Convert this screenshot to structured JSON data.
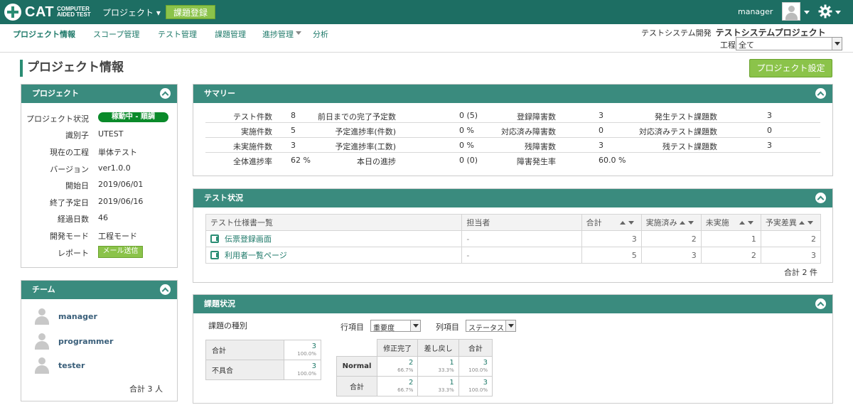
{
  "app": {
    "logo_main": "CAT",
    "logo_sub": "COMPUTER AIDED TEST",
    "project_menu": "プロジェクト",
    "register_issue": "課題登録",
    "user": "manager"
  },
  "nav": {
    "items": [
      "プロジェクト情報",
      "スコープ管理",
      "テスト管理",
      "課題管理",
      "進捗管理",
      "分析"
    ]
  },
  "context": {
    "org": "テストシステム開発",
    "project": "テストシステムプロジェクト",
    "process_label": "工程",
    "process_value": "全て"
  },
  "page": {
    "title": "プロジェクト情報",
    "settings_button": "プロジェクト設定"
  },
  "project_panel": {
    "title": "プロジェクト",
    "labels": [
      "プロジェクト状況",
      "識別子",
      "現在の工程",
      "バージョン",
      "開始日",
      "終了予定日",
      "経過日数",
      "開発モード",
      "レポート"
    ],
    "status": "稼動中 - 順調",
    "identifier": "UTEST",
    "process": "単体テスト",
    "version": "ver1.0.0",
    "start": "2019/06/01",
    "end": "2019/06/16",
    "elapsed": "46",
    "mode": "工程モード",
    "report_button": "メール送信"
  },
  "team_panel": {
    "title": "チーム",
    "members": [
      "manager",
      "programmer",
      "tester"
    ],
    "total": "合計 3 人"
  },
  "summary": {
    "title": "サマリー",
    "rows": [
      [
        "テスト件数",
        "8",
        "前日までの完了予定数",
        "0 (5)",
        "登録障害数",
        "3",
        "発生テスト課題数",
        "3"
      ],
      [
        "実施件数",
        "5",
        "予定進捗率(件数)",
        "0 %",
        "対応済み障害数",
        "0",
        "対応済みテスト課題数",
        "0"
      ],
      [
        "未実施件数",
        "3",
        "予定進捗率(工数)",
        "0 %",
        "残障害数",
        "3",
        "残テスト課題数",
        "3"
      ],
      [
        "全体進捗率",
        "62 %",
        "本日の進捗",
        "0 (0)",
        "障害発生率",
        "60.0 %",
        "",
        ""
      ]
    ]
  },
  "test_status": {
    "title": "テスト状況",
    "headers": [
      "テスト仕様書一覧",
      "担当者",
      "合計",
      "実施済み",
      "未実施",
      "予実差異"
    ],
    "rows": [
      [
        "伝票登録画面",
        "-",
        "3",
        "2",
        "1",
        "2"
      ],
      [
        "利用者一覧ページ",
        "-",
        "5",
        "3",
        "2",
        "3"
      ]
    ],
    "total": "合計 2 件"
  },
  "issue_status": {
    "title": "課題状況",
    "kind_label": "課題の種別",
    "row_label": "行項目",
    "row_value": "重要度",
    "col_label": "列項目",
    "col_value": "ステータス",
    "kind_rows": [
      [
        "合計",
        "3",
        "100.0%"
      ],
      [
        "不具合",
        "3",
        "100.0%"
      ]
    ],
    "matrix_headers": [
      "修正完了",
      "差し戻し",
      "合計"
    ],
    "matrix_rows": [
      {
        "label": "Normal",
        "cells": [
          [
            "2",
            "66.7%"
          ],
          [
            "1",
            "33.3%"
          ],
          [
            "3",
            "100.0%"
          ]
        ]
      },
      {
        "label": "合計",
        "cells": [
          [
            "2",
            "66.7%"
          ],
          [
            "1",
            "33.3%"
          ],
          [
            "3",
            "100.0%"
          ]
        ]
      }
    ]
  }
}
